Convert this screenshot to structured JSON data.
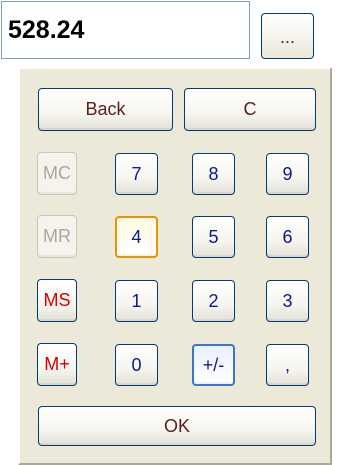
{
  "display": {
    "value": "528.24"
  },
  "browse_button": {
    "label": "..."
  },
  "keypad": {
    "back": "Back",
    "clear": "C",
    "mc": "MC",
    "mr": "MR",
    "ms": "MS",
    "mplus": "M+",
    "d7": "7",
    "d8": "8",
    "d9": "9",
    "d4": "4",
    "d5": "5",
    "d6": "6",
    "d1": "1",
    "d2": "2",
    "d3": "3",
    "d0": "0",
    "sign": "+/-",
    "decimal": ",",
    "ok": "OK"
  },
  "colors": {
    "button_text": "#0a1a8a",
    "memory_active_text": "#d60000",
    "disabled_text": "#aca899",
    "focus_ring": "#e59700",
    "panel_background": "#ece9d8"
  }
}
